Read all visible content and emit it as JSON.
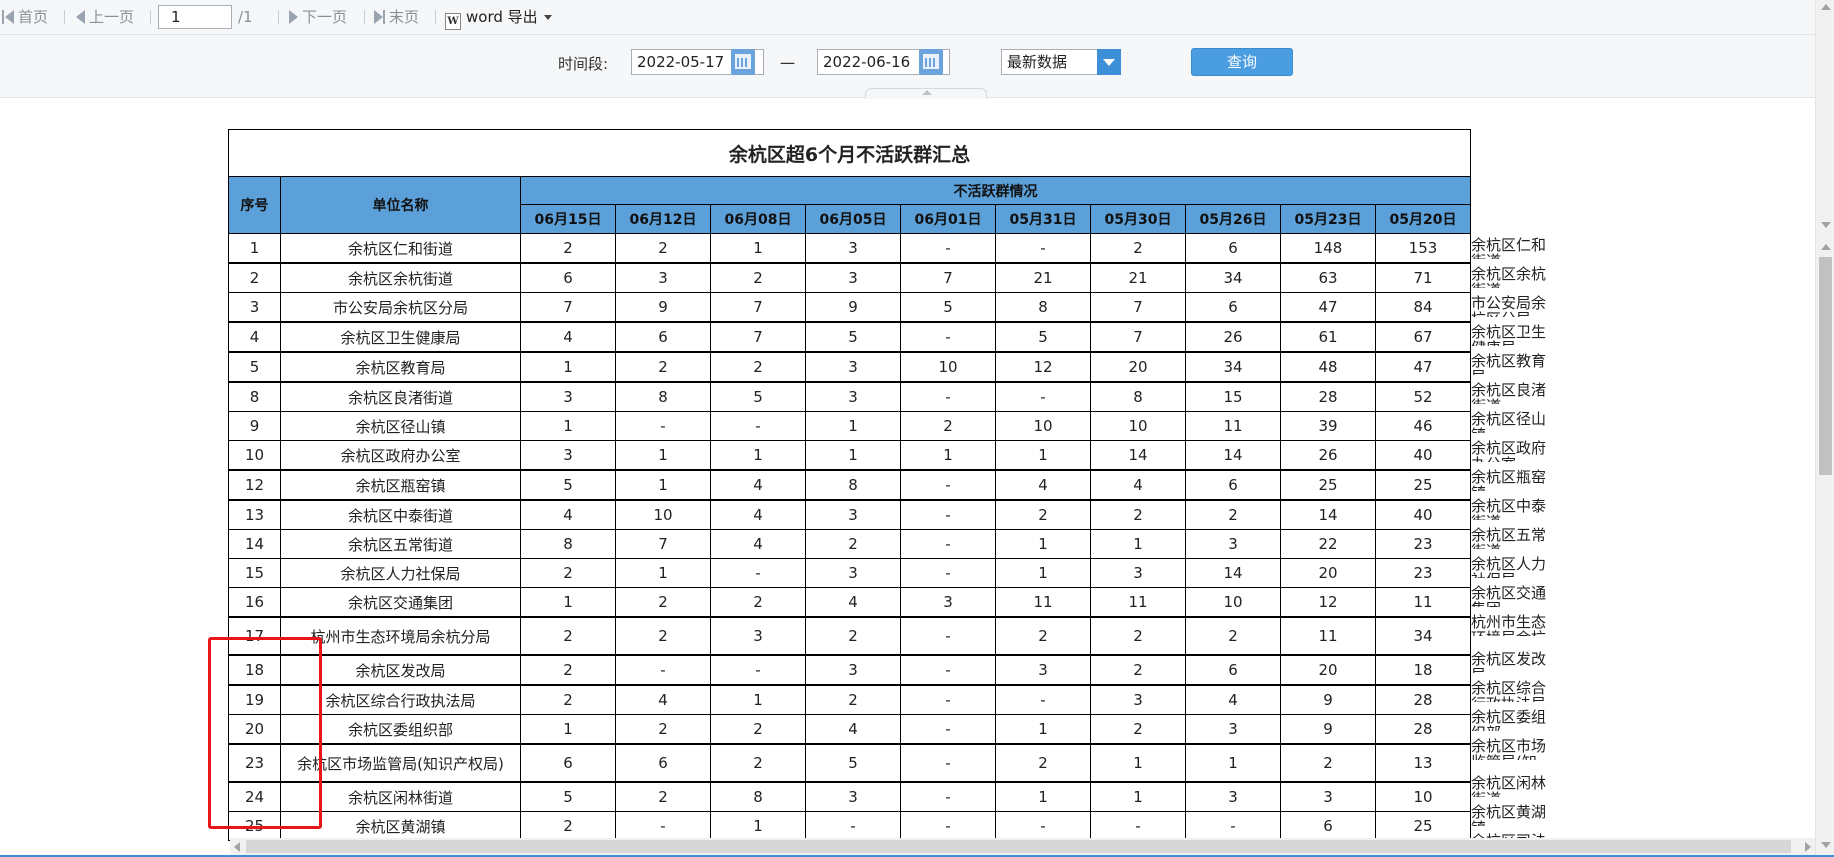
{
  "toolbar": {
    "first": "首页",
    "prev": "上一页",
    "page_value": "1",
    "page_total": "/1",
    "next": "下一页",
    "last": "末页",
    "word_icon_letter": "W",
    "export": "word 导出"
  },
  "filter": {
    "period_label": "时间段:",
    "start_date": "2022-05-17",
    "dash": "一",
    "end_date": "2022-06-16",
    "select_value": "最新数据",
    "query_button": "查询"
  },
  "report": {
    "title": "余杭区超6个月不活跃群汇总",
    "col_index": "序号",
    "col_unit": "单位名称",
    "group_header": "不活跃群情况",
    "dates": [
      "06月15日",
      "06月12日",
      "06月08日",
      "06月05日",
      "06月01日",
      "05月31日",
      "05月30日",
      "05月26日",
      "05月23日",
      "05月20日"
    ],
    "rows": [
      {
        "idx": "1",
        "name": "余杭区仁和街道",
        "v": [
          "2",
          "2",
          "1",
          "3",
          "-",
          "-",
          "2",
          "6",
          "148",
          "153"
        ]
      },
      {
        "idx": "2",
        "name": "余杭区余杭街道",
        "v": [
          "6",
          "3",
          "2",
          "3",
          "7",
          "21",
          "21",
          "34",
          "63",
          "71"
        ]
      },
      {
        "idx": "3",
        "name": "市公安局余杭区分局",
        "v": [
          "7",
          "9",
          "7",
          "9",
          "5",
          "8",
          "7",
          "6",
          "47",
          "84"
        ]
      },
      {
        "idx": "4",
        "name": "余杭区卫生健康局",
        "v": [
          "4",
          "6",
          "7",
          "5",
          "-",
          "5",
          "7",
          "26",
          "61",
          "67"
        ]
      },
      {
        "idx": "5",
        "name": "余杭区教育局",
        "v": [
          "1",
          "2",
          "2",
          "3",
          "10",
          "12",
          "20",
          "34",
          "48",
          "47"
        ]
      },
      {
        "idx": "8",
        "name": "余杭区良渚街道",
        "v": [
          "3",
          "8",
          "5",
          "3",
          "-",
          "-",
          "8",
          "15",
          "28",
          "52"
        ]
      },
      {
        "idx": "9",
        "name": "余杭区径山镇",
        "v": [
          "1",
          "-",
          "-",
          "1",
          "2",
          "10",
          "10",
          "11",
          "39",
          "46"
        ]
      },
      {
        "idx": "10",
        "name": "余杭区政府办公室",
        "v": [
          "3",
          "1",
          "1",
          "1",
          "1",
          "1",
          "14",
          "14",
          "26",
          "40"
        ]
      },
      {
        "idx": "12",
        "name": "余杭区瓶窑镇",
        "v": [
          "5",
          "1",
          "4",
          "8",
          "-",
          "4",
          "4",
          "6",
          "25",
          "25"
        ]
      },
      {
        "idx": "13",
        "name": "余杭区中泰街道",
        "v": [
          "4",
          "10",
          "4",
          "3",
          "-",
          "2",
          "2",
          "2",
          "14",
          "40"
        ]
      },
      {
        "idx": "14",
        "name": "余杭区五常街道",
        "v": [
          "8",
          "7",
          "4",
          "2",
          "-",
          "1",
          "1",
          "3",
          "22",
          "23"
        ]
      },
      {
        "idx": "15",
        "name": "余杭区人力社保局",
        "v": [
          "2",
          "1",
          "-",
          "3",
          "-",
          "1",
          "3",
          "14",
          "20",
          "23"
        ]
      },
      {
        "idx": "16",
        "name": "余杭区交通集团",
        "v": [
          "1",
          "2",
          "2",
          "4",
          "3",
          "11",
          "11",
          "10",
          "12",
          "11"
        ]
      },
      {
        "idx": "17",
        "name": "杭州市生态环境局余杭分局",
        "v": [
          "2",
          "2",
          "3",
          "2",
          "-",
          "2",
          "2",
          "2",
          "11",
          "34"
        ]
      },
      {
        "idx": "18",
        "name": "余杭区发改局",
        "v": [
          "2",
          "-",
          "-",
          "3",
          "-",
          "3",
          "2",
          "6",
          "20",
          "18"
        ]
      },
      {
        "idx": "19",
        "name": "余杭区综合行政执法局",
        "v": [
          "2",
          "4",
          "1",
          "2",
          "-",
          "-",
          "3",
          "4",
          "9",
          "28"
        ]
      },
      {
        "idx": "20",
        "name": "余杭区委组织部",
        "v": [
          "1",
          "2",
          "2",
          "4",
          "-",
          "1",
          "2",
          "3",
          "9",
          "28"
        ]
      },
      {
        "idx": "23",
        "name": "余杭区市场监管局(知识产权局)",
        "v": [
          "6",
          "6",
          "2",
          "5",
          "-",
          "2",
          "1",
          "1",
          "2",
          "13"
        ]
      },
      {
        "idx": "24",
        "name": "余杭区闲林街道",
        "v": [
          "5",
          "2",
          "8",
          "3",
          "-",
          "1",
          "1",
          "3",
          "3",
          "10"
        ]
      },
      {
        "idx": "25",
        "name": "余杭区黄湖镇",
        "v": [
          "2",
          "-",
          "1",
          "-",
          "-",
          "-",
          "-",
          "-",
          "6",
          "25"
        ]
      }
    ]
  },
  "side_names": [
    "余杭区仁和街道",
    "余杭区余杭街道",
    "市公安局余杭区分局",
    "余杭区卫生健康局",
    "余杭区教育局",
    "余杭区良渚街道",
    "余杭区径山镇",
    "余杭区政府办公室",
    "余杭区瓶窑镇",
    "余杭区中泰街道",
    "余杭区五常街道",
    "余杭区人力社保局",
    "余杭区交通集团",
    "杭州市生态环境局余杭分局",
    "余杭区发改局",
    "余杭区综合行政执法局",
    "余杭区委组织部",
    "余杭区市场监管局(知识产权局)",
    "余杭区闲林街道",
    "余杭区黄湖镇",
    "余杭区司法局"
  ],
  "colors": {
    "header_blue": "#5ba0d8",
    "highlight_red": "#e8161b",
    "button_blue": "#4a9de0"
  }
}
